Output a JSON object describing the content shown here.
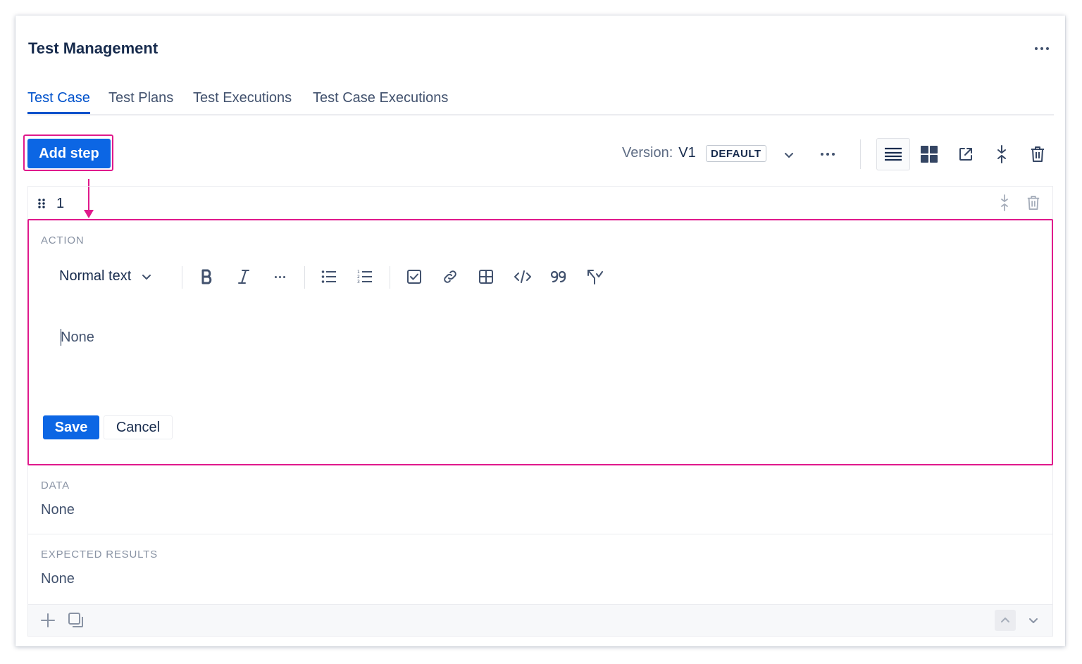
{
  "header": {
    "title": "Test Management"
  },
  "tabs": [
    {
      "label": "Test Case",
      "active": true
    },
    {
      "label": "Test Plans",
      "active": false
    },
    {
      "label": "Test Executions",
      "active": false
    },
    {
      "label": "Test Case Executions",
      "active": false
    }
  ],
  "toolbar": {
    "add_step_label": "Add step",
    "version_label": "Version:",
    "version_value": "V1",
    "version_badge": "DEFAULT"
  },
  "step": {
    "number": "1",
    "action_label": "ACTION",
    "text_style": "Normal text",
    "editor_placeholder": "None",
    "save_label": "Save",
    "cancel_label": "Cancel",
    "data_label": "DATA",
    "data_value": "None",
    "expected_label": "EXPECTED RESULTS",
    "expected_value": "None"
  },
  "colors": {
    "accent": "#0c66e4",
    "highlight": "#e0198c",
    "text": "#172b4d",
    "muted": "#8993a4"
  },
  "icons": [
    "more-icon",
    "chevron-down-icon",
    "list-view-icon",
    "grid-view-icon",
    "open-external-icon",
    "collapse-icon",
    "trash-icon",
    "drag-handle-icon",
    "bold-icon",
    "italic-icon",
    "bullet-list-icon",
    "numbered-list-icon",
    "checkbox-icon",
    "link-icon",
    "table-icon",
    "code-icon",
    "quote-icon",
    "clear-format-icon",
    "add-icon",
    "clone-icon",
    "chevron-up-icon"
  ]
}
